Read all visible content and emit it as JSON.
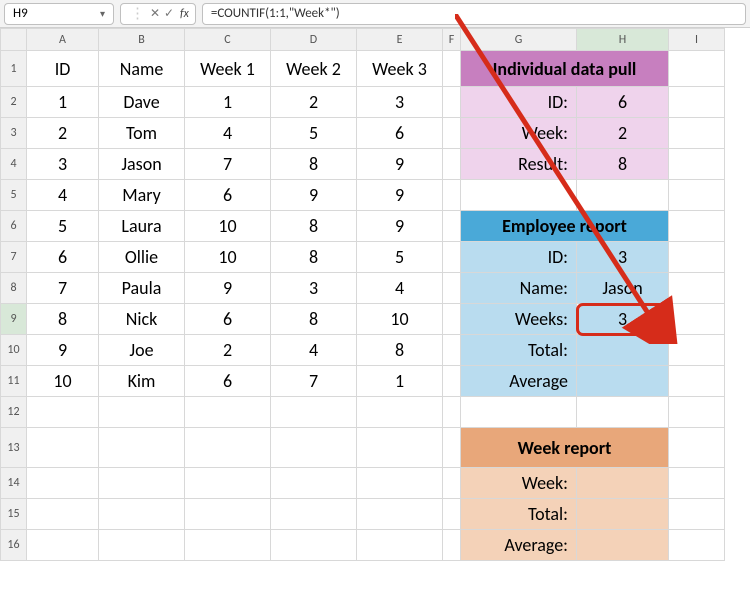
{
  "formula_bar": {
    "cell_ref": "H9",
    "cancel_icon": "✕",
    "confirm_icon": "✓",
    "fx_label": "fx",
    "formula": "=COUNTIF(1:1,\"Week*\")"
  },
  "columns": [
    "A",
    "B",
    "C",
    "D",
    "E",
    "F",
    "G",
    "H",
    "I"
  ],
  "row_numbers": [
    "1",
    "2",
    "3",
    "4",
    "5",
    "6",
    "7",
    "8",
    "9",
    "10",
    "11",
    "12",
    "13",
    "14",
    "15",
    "16"
  ],
  "data_headers": {
    "id": "ID",
    "name": "Name",
    "w1": "Week 1",
    "w2": "Week 2",
    "w3": "Week 3"
  },
  "rows": [
    {
      "id": "1",
      "name": "Dave",
      "w1": "1",
      "w2": "2",
      "w3": "3"
    },
    {
      "id": "2",
      "name": "Tom",
      "w1": "4",
      "w2": "5",
      "w3": "6"
    },
    {
      "id": "3",
      "name": "Jason",
      "w1": "7",
      "w2": "8",
      "w3": "9"
    },
    {
      "id": "4",
      "name": "Mary",
      "w1": "6",
      "w2": "9",
      "w3": "9"
    },
    {
      "id": "5",
      "name": "Laura",
      "w1": "10",
      "w2": "8",
      "w3": "9"
    },
    {
      "id": "6",
      "name": "Ollie",
      "w1": "10",
      "w2": "8",
      "w3": "5"
    },
    {
      "id": "7",
      "name": "Paula",
      "w1": "9",
      "w2": "3",
      "w3": "4"
    },
    {
      "id": "8",
      "name": "Nick",
      "w1": "6",
      "w2": "8",
      "w3": "10"
    },
    {
      "id": "9",
      "name": "Joe",
      "w1": "2",
      "w2": "4",
      "w3": "8"
    },
    {
      "id": "10",
      "name": "Kim",
      "w1": "6",
      "w2": "7",
      "w3": "1"
    }
  ],
  "panels": {
    "individual": {
      "title": "Individual data pull",
      "id_label": "ID:",
      "id_val": "6",
      "week_label": "Week:",
      "week_val": "2",
      "result_label": "Result:",
      "result_val": "8"
    },
    "employee": {
      "title": "Employee report",
      "id_label": "ID:",
      "id_val": "3",
      "name_label": "Name:",
      "name_val": "Jason",
      "weeks_label": "Weeks:",
      "weeks_val": "3",
      "total_label": "Total:",
      "total_val": "",
      "avg_label": "Average",
      "avg_val": ""
    },
    "week": {
      "title": "Week report",
      "week_label": "Week:",
      "total_label": "Total:",
      "avg_label": "Average:"
    }
  },
  "selection": {
    "cell": "H9"
  }
}
